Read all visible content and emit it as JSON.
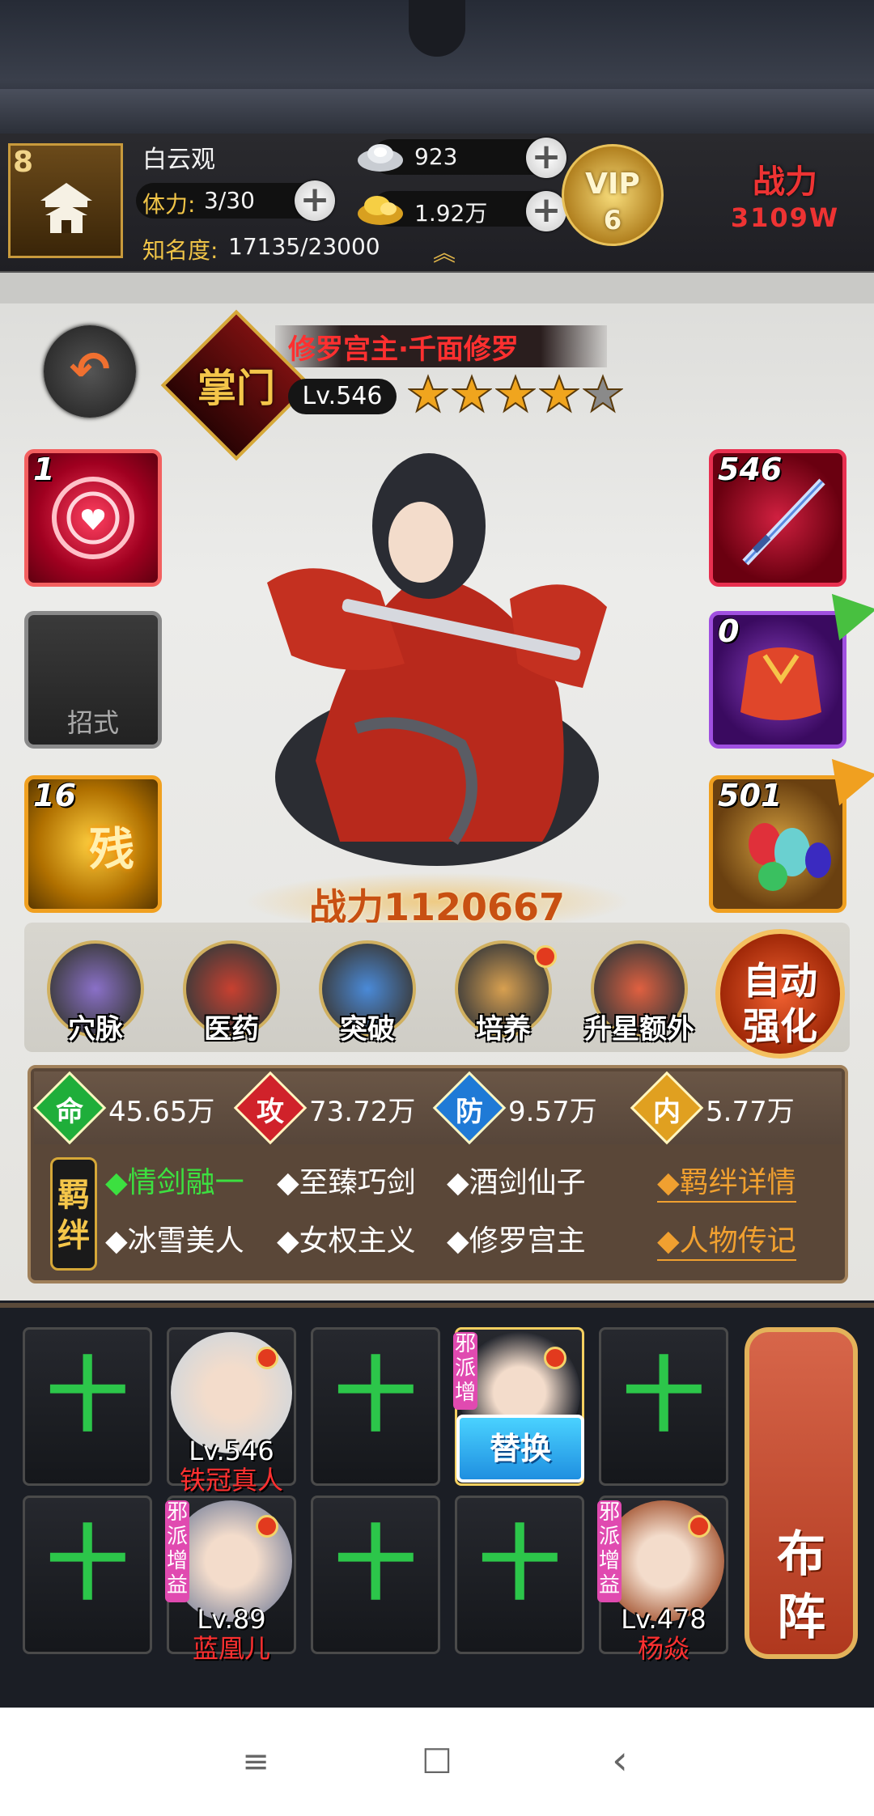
{
  "player": {
    "level": "8",
    "name": "白云观",
    "stamina_label": "体力:",
    "stamina_value": "3/30",
    "fame_label": "知名度:",
    "fame_value": "17135/23000"
  },
  "currency": {
    "silver": "923",
    "gold": "1.92万"
  },
  "vip": {
    "label": "VIP",
    "level": "6"
  },
  "total_power": {
    "label": "战力",
    "value": "3109W"
  },
  "hero": {
    "rank": "掌门",
    "name": "修罗宫主·千面修罗",
    "level": "Lv.546",
    "stars": 4,
    "max_stars": 5,
    "power": "战力1120667"
  },
  "slots": {
    "left": [
      {
        "count": "1",
        "label": ""
      },
      {
        "count": "",
        "label": "招式"
      },
      {
        "count": "16",
        "label": "残"
      }
    ],
    "right": [
      {
        "count": "546"
      },
      {
        "count": "0"
      },
      {
        "count": "501"
      }
    ]
  },
  "actions": [
    {
      "label": "穴脉",
      "icon": "meridian-icon",
      "dot": false
    },
    {
      "label": "医药",
      "icon": "medicine-icon",
      "dot": false
    },
    {
      "label": "突破",
      "icon": "breakthrough-icon",
      "dot": false
    },
    {
      "label": "培养",
      "icon": "cultivate-icon",
      "dot": true
    },
    {
      "label": "升星额外",
      "icon": "star-up-icon",
      "dot": false
    }
  ],
  "auto": {
    "line1": "自动",
    "line2": "强化"
  },
  "stats": [
    {
      "char": "命",
      "value": "45.65万",
      "color": "#1fae3a"
    },
    {
      "char": "攻",
      "value": "73.72万",
      "color": "#d0222a"
    },
    {
      "char": "防",
      "value": "9.57万",
      "color": "#1f7ad6"
    },
    {
      "char": "内",
      "value": "5.77万",
      "color": "#e0a020"
    }
  ],
  "bonds": {
    "tag": "羁绊",
    "row1": [
      "◆情剑融一",
      "◆至臻巧剑",
      "◆酒剑仙子"
    ],
    "row2": [
      "◆冰雪美人",
      "◆女权主义",
      "◆修罗宫主"
    ],
    "details_link": "◆羁绊详情",
    "bio_link": "◆人物传记"
  },
  "lineup": {
    "row1": [
      {
        "type": "empty"
      },
      {
        "type": "hero",
        "level": "Lv.546",
        "name": "铁冠真人"
      },
      {
        "type": "empty"
      },
      {
        "type": "current",
        "tag": "邪派增",
        "button": "替换"
      },
      {
        "type": "empty"
      }
    ],
    "row2": [
      {
        "type": "empty"
      },
      {
        "type": "hero",
        "tag": "邪派增益",
        "level": "Lv.89",
        "name": "蓝凰儿"
      },
      {
        "type": "empty"
      },
      {
        "type": "empty"
      },
      {
        "type": "hero",
        "tag": "邪派增益",
        "level": "Lv.478",
        "name": "杨焱"
      }
    ],
    "plus_symbol": "十",
    "formation_line1": "布",
    "formation_line2": "阵"
  },
  "nav": {
    "menu": "≡",
    "home": "□",
    "back": "‹"
  }
}
